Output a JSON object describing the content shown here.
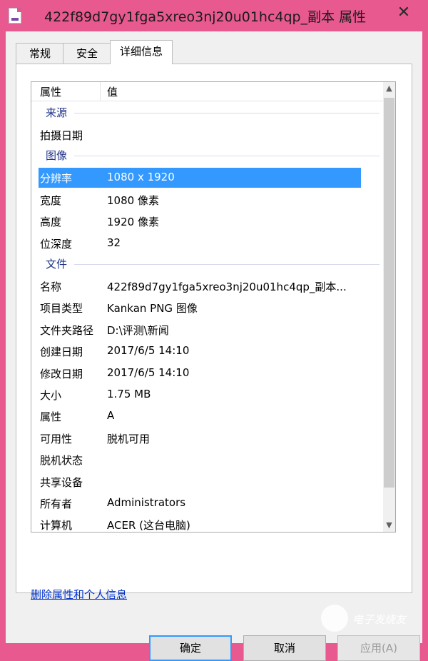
{
  "window": {
    "title": "422f89d7gy1fga5xreo3nj20u01hc4qp_副本 属性",
    "close_glyph": "✕"
  },
  "tabs": [
    "常规",
    "安全",
    "详细信息"
  ],
  "active_tab": "详细信息",
  "list": {
    "col_property": "属性",
    "col_value": "值",
    "groups": [
      {
        "label": "来源",
        "rows": [
          {
            "k": "拍摄日期",
            "v": ""
          }
        ]
      },
      {
        "label": "图像",
        "rows": [
          {
            "k": "分辨率",
            "v": "1080 x 1920",
            "selected": true
          },
          {
            "k": "宽度",
            "v": "1080 像素"
          },
          {
            "k": "高度",
            "v": "1920 像素"
          },
          {
            "k": "位深度",
            "v": "32"
          }
        ]
      },
      {
        "label": "文件",
        "rows": [
          {
            "k": "名称",
            "v": "422f89d7gy1fga5xreo3nj20u01hc4qp_副本..."
          },
          {
            "k": "项目类型",
            "v": "Kankan PNG 图像"
          },
          {
            "k": "文件夹路径",
            "v": "D:\\评测\\新闻"
          },
          {
            "k": "创建日期",
            "v": "2017/6/5 14:10"
          },
          {
            "k": "修改日期",
            "v": "2017/6/5 14:10"
          },
          {
            "k": "大小",
            "v": "1.75 MB"
          },
          {
            "k": "属性",
            "v": "A"
          },
          {
            "k": "可用性",
            "v": "脱机可用"
          },
          {
            "k": "脱机状态",
            "v": ""
          },
          {
            "k": "共享设备",
            "v": ""
          },
          {
            "k": "所有者",
            "v": "Administrators"
          },
          {
            "k": "计算机",
            "v": "ACER (这台电脑)"
          }
        ]
      }
    ]
  },
  "link_remove": "删除属性和个人信息",
  "buttons": {
    "ok": "确定",
    "cancel": "取消",
    "apply": "应用(A)"
  },
  "watermark": "电子发烧友",
  "icons": {
    "file": "png-file-icon",
    "up": "▲",
    "down": "▼"
  }
}
